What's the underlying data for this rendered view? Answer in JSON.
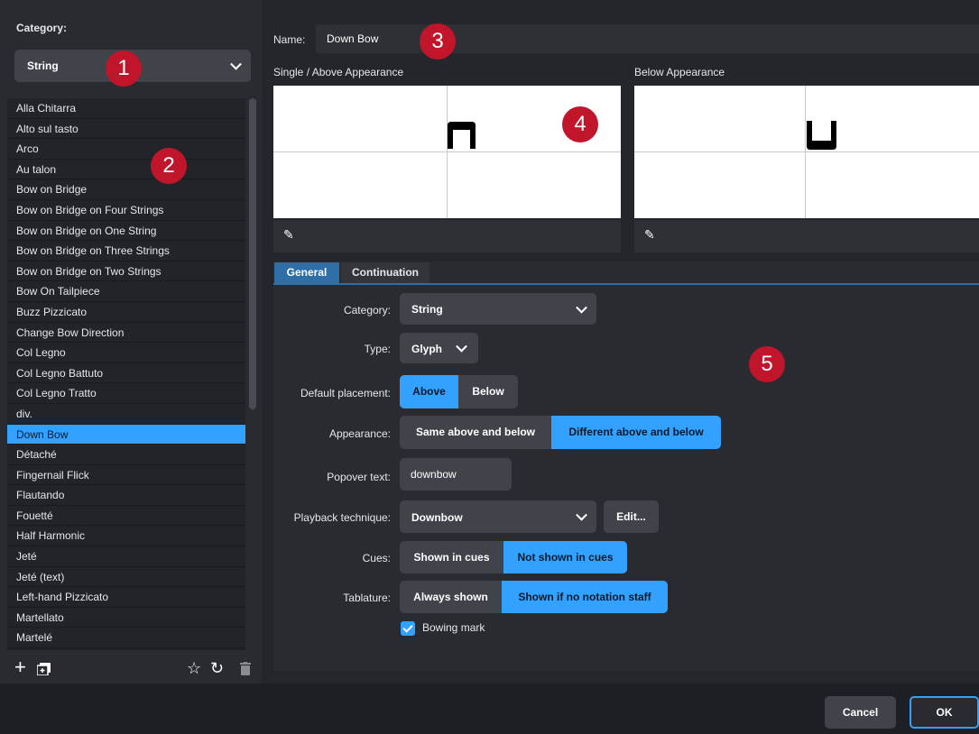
{
  "left_panel": {
    "category_title": "Category:",
    "category_value": "String",
    "items": [
      "Alla Chitarra",
      "Alto sul tasto",
      "Arco",
      "Au talon",
      "Bow on Bridge",
      "Bow on Bridge on Four Strings",
      "Bow on Bridge on One String",
      "Bow on Bridge on Three Strings",
      "Bow on Bridge on Two Strings",
      "Bow On Tailpiece",
      "Buzz Pizzicato",
      "Change Bow Direction",
      "Col Legno",
      "Col Legno Battuto",
      "Col Legno Tratto",
      "div.",
      "Down Bow",
      "Détaché",
      "Fingernail Flick",
      "Flautando",
      "Fouetté",
      "Half Harmonic",
      "Jeté",
      "Jeté (text)",
      "Left-hand Pizzicato",
      "Martellato",
      "Martelé"
    ],
    "selected_item": "Down Bow",
    "toolbar_icons": [
      "plus-icon",
      "duplicate-icon",
      "star-icon",
      "reset-icon",
      "trash-icon"
    ]
  },
  "name": {
    "label": "Name:",
    "value": "Down Bow"
  },
  "previews": {
    "single_above_label": "Single / Above Appearance",
    "below_label": "Below Appearance"
  },
  "tabs": [
    "General",
    "Continuation"
  ],
  "form": {
    "category": {
      "label": "Category:",
      "value": "String"
    },
    "type": {
      "label": "Type:",
      "value": "Glyph"
    },
    "default_placement": {
      "label": "Default placement:",
      "options": [
        "Above",
        "Below"
      ],
      "selected": "Above"
    },
    "appearance": {
      "label": "Appearance:",
      "options": [
        "Same above and below",
        "Different above and below"
      ],
      "selected": "Different above and below"
    },
    "popover_text": {
      "label": "Popover text:",
      "value": "downbow"
    },
    "playback_technique": {
      "label": "Playback technique:",
      "value": "Downbow",
      "edit_button": "Edit..."
    },
    "cues": {
      "label": "Cues:",
      "options": [
        "Shown in cues",
        "Not shown in cues"
      ],
      "selected": "Not shown in cues"
    },
    "tablature": {
      "label": "Tablature:",
      "options": [
        "Always shown",
        "Shown if no notation staff"
      ],
      "selected": "Shown if no notation staff"
    },
    "bowing_mark": {
      "label": "Bowing mark",
      "checked": true
    }
  },
  "footer": {
    "cancel": "Cancel",
    "ok": "OK"
  },
  "callouts": [
    "1",
    "2",
    "3",
    "4",
    "5"
  ],
  "colors": {
    "accent": "#33a1ff",
    "callout": "#c0152a",
    "background": "#1e1f24"
  }
}
